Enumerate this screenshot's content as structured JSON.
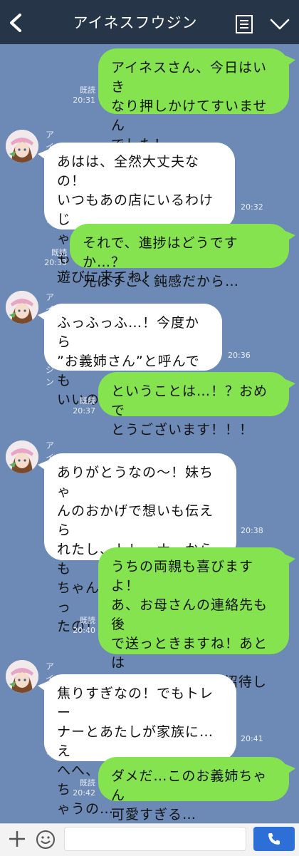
{
  "header": {
    "title": "アイネスフウジン",
    "icons": [
      "back-icon",
      "menu-icon",
      "chevron-down-icon"
    ]
  },
  "messages": [
    {
      "from": "me",
      "text": "アイネスさん、今日はいき\nなり押しかけてすいません\nでした！",
      "read": "既読",
      "time": "20:31"
    },
    {
      "from": "them",
      "sender": "アイネスフウジン",
      "text": "あはは、全然大丈夫なの！\nいつもあの店にいるわけじ\nゃないけど、またいつでも\n遊びに来てね！",
      "time": "20:32"
    },
    {
      "from": "me",
      "text": "それで、進捗はどうですか…？\n兄はすごく鈍感だから…",
      "read": "既読",
      "time": "20:33"
    },
    {
      "from": "them",
      "sender": "アイネスフウジン",
      "text": "ふっふっふ…！今度から\n”お義姉さん”と呼んでも\nいいの！",
      "time": "20:36"
    },
    {
      "from": "me",
      "text": "ということは…！？おめで\nとうございます！！！",
      "read": "既読",
      "time": "20:37"
    },
    {
      "from": "them",
      "sender": "アイネスフウジン",
      "text": "ありがとうなの〜！妹ちゃ\nんのおかげで想いも伝えら\nれたし、トレーナーからも\nちゃんとお返事してもらっ\nたの！",
      "time": "20:38"
    },
    {
      "from": "me",
      "text": "うちの両親も喜びますよ！\nあ、お母さんの連絡先も後\nで送っときますね！あとは\n家族グループにも招待しな\nいと…",
      "read": "既読",
      "time": "20:40"
    },
    {
      "from": "them",
      "sender": "アイネスフウジン",
      "text": "焦りすぎなの！でもトレー\nナーとあたしが家族に…え\nへへ、自然と顔がにやけち\nゃうの…",
      "time": "20:41"
    },
    {
      "from": "me",
      "text": "ダメだ…このお義姉ちゃん\n可愛すぎる…",
      "read": "既読",
      "time": "20:42"
    }
  ],
  "input": {
    "placeholder": "",
    "icons": [
      "plus-icon",
      "emoji-icon",
      "phone-icon"
    ]
  },
  "colors": {
    "background": "#6d89b5",
    "header": "#263548",
    "my_bubble": "#84e34f",
    "their_bubble": "#ffffff",
    "send_button": "#2d6fd6"
  }
}
